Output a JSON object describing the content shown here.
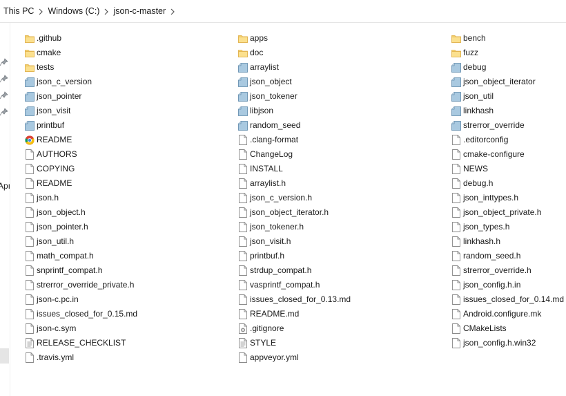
{
  "breadcrumb": [
    "This PC",
    "Windows (C:)",
    "json-c-master"
  ],
  "nav": {
    "partial_label": "Apı"
  },
  "files": [
    {
      "name": ".github",
      "type": "folder"
    },
    {
      "name": "apps",
      "type": "folder"
    },
    {
      "name": "bench",
      "type": "folder"
    },
    {
      "name": "cmake",
      "type": "folder"
    },
    {
      "name": "doc",
      "type": "folder"
    },
    {
      "name": "fuzz",
      "type": "folder"
    },
    {
      "name": "tests",
      "type": "folder"
    },
    {
      "name": "arraylist",
      "type": "object"
    },
    {
      "name": "debug",
      "type": "object"
    },
    {
      "name": "json_c_version",
      "type": "object"
    },
    {
      "name": "json_object",
      "type": "object"
    },
    {
      "name": "json_object_iterator",
      "type": "object"
    },
    {
      "name": "json_pointer",
      "type": "object"
    },
    {
      "name": "json_tokener",
      "type": "object"
    },
    {
      "name": "json_util",
      "type": "object"
    },
    {
      "name": "json_visit",
      "type": "object"
    },
    {
      "name": "libjson",
      "type": "object"
    },
    {
      "name": "linkhash",
      "type": "object"
    },
    {
      "name": "printbuf",
      "type": "object"
    },
    {
      "name": "random_seed",
      "type": "object"
    },
    {
      "name": "strerror_override",
      "type": "object"
    },
    {
      "name": "README",
      "type": "chrome"
    },
    {
      "name": ".clang-format",
      "type": "file"
    },
    {
      "name": ".editorconfig",
      "type": "file"
    },
    {
      "name": "AUTHORS",
      "type": "file"
    },
    {
      "name": "ChangeLog",
      "type": "file"
    },
    {
      "name": "cmake-configure",
      "type": "file"
    },
    {
      "name": "COPYING",
      "type": "file"
    },
    {
      "name": "INSTALL",
      "type": "file"
    },
    {
      "name": "NEWS",
      "type": "file"
    },
    {
      "name": "README",
      "type": "file"
    },
    {
      "name": "arraylist.h",
      "type": "file"
    },
    {
      "name": "debug.h",
      "type": "file"
    },
    {
      "name": "json.h",
      "type": "file"
    },
    {
      "name": "json_c_version.h",
      "type": "file"
    },
    {
      "name": "json_inttypes.h",
      "type": "file"
    },
    {
      "name": "json_object.h",
      "type": "file"
    },
    {
      "name": "json_object_iterator.h",
      "type": "file"
    },
    {
      "name": "json_object_private.h",
      "type": "file"
    },
    {
      "name": "json_pointer.h",
      "type": "file"
    },
    {
      "name": "json_tokener.h",
      "type": "file"
    },
    {
      "name": "json_types.h",
      "type": "file"
    },
    {
      "name": "json_util.h",
      "type": "file"
    },
    {
      "name": "json_visit.h",
      "type": "file"
    },
    {
      "name": "linkhash.h",
      "type": "file"
    },
    {
      "name": "math_compat.h",
      "type": "file"
    },
    {
      "name": "printbuf.h",
      "type": "file"
    },
    {
      "name": "random_seed.h",
      "type": "file"
    },
    {
      "name": "snprintf_compat.h",
      "type": "file"
    },
    {
      "name": "strdup_compat.h",
      "type": "file"
    },
    {
      "name": "strerror_override.h",
      "type": "file"
    },
    {
      "name": "strerror_override_private.h",
      "type": "file"
    },
    {
      "name": "vasprintf_compat.h",
      "type": "file"
    },
    {
      "name": "json_config.h.in",
      "type": "file"
    },
    {
      "name": "json-c.pc.in",
      "type": "file"
    },
    {
      "name": "issues_closed_for_0.13.md",
      "type": "file"
    },
    {
      "name": "issues_closed_for_0.14.md",
      "type": "file"
    },
    {
      "name": "issues_closed_for_0.15.md",
      "type": "file"
    },
    {
      "name": "README.md",
      "type": "file"
    },
    {
      "name": "Android.configure.mk",
      "type": "file"
    },
    {
      "name": "json-c.sym",
      "type": "file"
    },
    {
      "name": ".gitignore",
      "type": "config"
    },
    {
      "name": "CMakeLists",
      "type": "file"
    },
    {
      "name": "RELEASE_CHECKLIST",
      "type": "text"
    },
    {
      "name": "STYLE",
      "type": "text"
    },
    {
      "name": "json_config.h.win32",
      "type": "file"
    },
    {
      "name": ".travis.yml",
      "type": "file"
    },
    {
      "name": "appveyor.yml",
      "type": "file"
    }
  ],
  "colors": {
    "folder": "#f8d775",
    "folder_dark": "#e8b84a",
    "object": "#9fc3dd",
    "object_dark": "#5a86a8"
  }
}
